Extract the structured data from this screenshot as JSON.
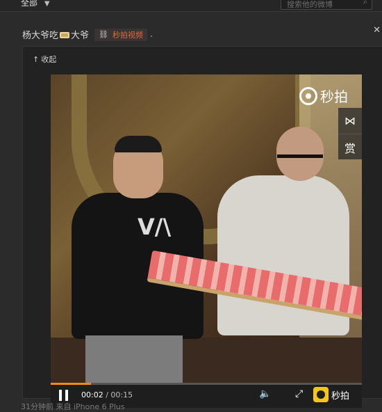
{
  "header": {
    "filter_label": "全部",
    "search_placeholder": "搜索他的微博"
  },
  "post": {
    "author": "杨大爷吃",
    "author_suffix": "大爷",
    "tag_label": "秒拍视频",
    "trailing": ".",
    "collapse_label": "收起"
  },
  "video": {
    "watermark_brand": "秒拍",
    "side_tools": [
      "share",
      "赏"
    ],
    "current_time": "00:02",
    "total_time": "00:15",
    "separator": " / ",
    "progress_fraction": 0.13,
    "brand_label": "秒拍",
    "accent_color": "#f08a1a"
  },
  "footer": {
    "text": "31分钟前 来自 iPhone 6 Plus"
  }
}
